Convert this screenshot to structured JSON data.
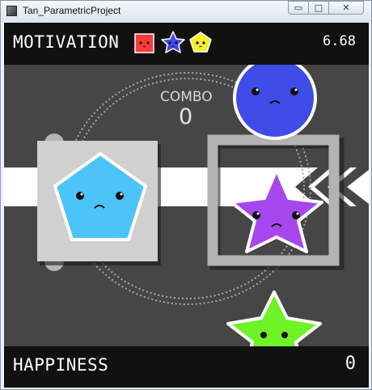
{
  "window": {
    "title": "Tan_ParametricProject",
    "minimize_glyph": "▭",
    "maximize_glyph": "□",
    "close_glyph": "✕"
  },
  "hud": {
    "motivation_label": "MOTIVATION",
    "motivation_value": "6.68",
    "motivation_icons": [
      {
        "icon": "red-square-face-icon",
        "color": "#ff3b3b"
      },
      {
        "icon": "blue-star-face-icon",
        "color": "#3f4ce8"
      },
      {
        "icon": "yellow-pentagon-face-icon",
        "color": "#f3ee2e"
      }
    ],
    "happiness_label": "HAPPINESS",
    "happiness_value": "0"
  },
  "combo": {
    "label": "COMBO",
    "value": "0"
  },
  "colors": {
    "background": "#464646",
    "hud": "#111111",
    "belt": "#ffffff",
    "left_frame": "#d0d0d0",
    "right_frame": "#b3b3b3",
    "blue_circle": "#3f4ce8",
    "cyan_pentagon": "#4cc4f8",
    "purple_star": "#a647ee",
    "green_star": "#6ef228"
  }
}
